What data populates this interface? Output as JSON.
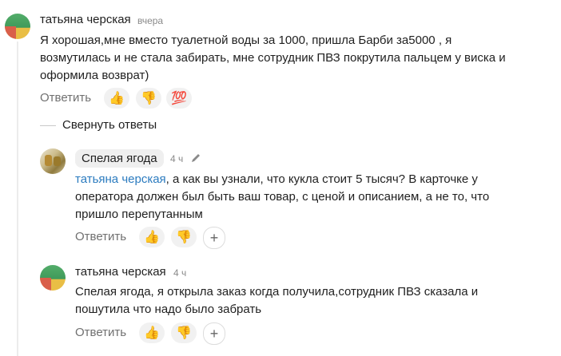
{
  "comment1": {
    "author": "татьяна черская",
    "time": "вчера",
    "text_lines": [
      "Я хорошая,мне вместо туалетной воды за 1000, пришла Барби за5000 , я",
      "возмутилась и не стала забирать, мне сотрудник ПВЗ покрутила пальцем у виска и",
      "оформила возврат)"
    ],
    "reply_label": "Ответить",
    "reactions": [
      "👍",
      "👎",
      "💯"
    ]
  },
  "collapse_label": "Свернуть ответы",
  "reply1": {
    "author": "Спелая ягода",
    "time": "4 ч",
    "mention": "татьяна черская",
    "text_first_rest": ", а как вы узнали, что кукла стоит 5 тысяч? В карточке у",
    "text_lines": [
      "оператора должен был быть ваш товар, с ценой и описанием, а не то, что",
      "пришло перепутанным"
    ],
    "reply_label": "Ответить",
    "reactions": [
      "👍",
      "👎",
      "+"
    ]
  },
  "reply2": {
    "author": "татьяна черская",
    "time": "4 ч",
    "text_lines": [
      "Спелая ягода, я открыла заказ когда получила,сотрудник ПВЗ сказала и",
      "пошутила что надо было забрать"
    ],
    "reply_label": "Ответить",
    "reactions": [
      "👍",
      "👎",
      "+"
    ]
  },
  "colors": {
    "mention": "#2b7bbf",
    "secondary_text": "#707070",
    "reaction_bg": "#f1f1f1"
  }
}
